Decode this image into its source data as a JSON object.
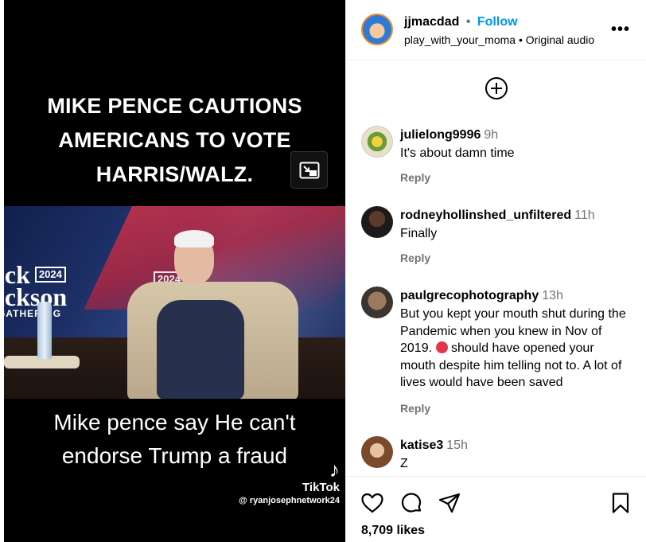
{
  "video": {
    "top_caption_line1": "MIKE PENCE CAUTIONS",
    "top_caption_line2": "AMERICANS TO VOTE",
    "top_caption_line3": "HARRIS/WALZ.",
    "bottom_caption_line1": "Mike pence say He can't",
    "bottom_caption_line2": "endorse Trump a fraud",
    "banner_left_line1": "ick",
    "banner_left_year": "2024",
    "banner_left_line2": "ickson",
    "banner_left_line3": "GATHERING",
    "banner_right_year": "2024",
    "watermark_brand": "TikTok",
    "watermark_handle": "@ ryanjosephnetwork24"
  },
  "header": {
    "username": "jjmacdad",
    "separator": "•",
    "follow_label": "Follow",
    "audio_user": "play_with_your_moma",
    "audio_label": "Original audio",
    "more_icon": "more-horizontal-icon"
  },
  "comments": [
    {
      "user": "julielong9996",
      "time": "9h",
      "text": "It's about damn time",
      "reply": "Reply"
    },
    {
      "user": "rodneyhollinshed_unfiltered",
      "time": "11h",
      "text": "Finally",
      "reply": "Reply"
    },
    {
      "user": "paulgrecophotography",
      "time": "13h",
      "text_before": "But you kept your mouth shut during the Pandemic when you knew in Nov of 2019.",
      "text_after": "should have opened your mouth despite him telling not to. A lot of lives would have been saved",
      "reply": "Reply"
    },
    {
      "user": "katise3",
      "time": "15h",
      "text": "Z"
    }
  ],
  "footer": {
    "likes": "8,709 likes"
  },
  "colors": {
    "follow_blue": "#0095f6",
    "muted_gray": "#737373",
    "divider": "#efefef"
  }
}
